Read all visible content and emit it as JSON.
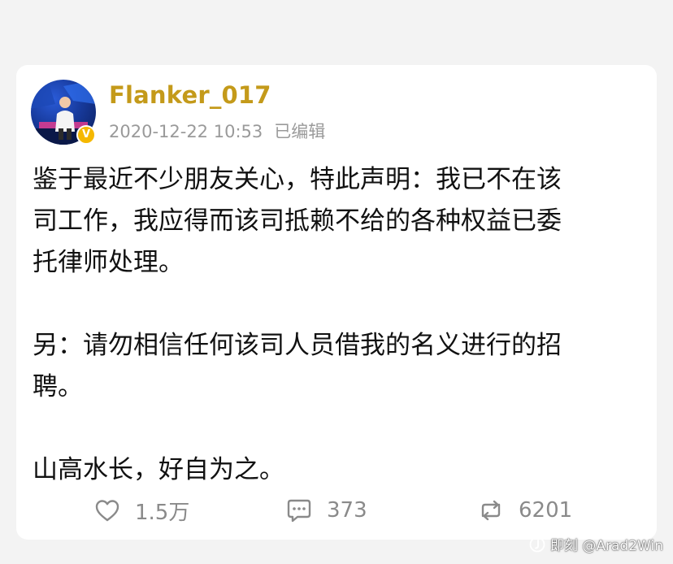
{
  "post": {
    "username": "Flanker_017",
    "datetime": "2020-12-22 10:53",
    "edited_label": "已编辑",
    "verified_mark": "V",
    "paragraphs": [
      [
        "鉴于最近不少朋友关心，特此声明：我已不在该",
        "司工作，我应得而该司抵赖不给的各种权益已委",
        "托律师处理。"
      ],
      [
        "另：请勿相信任何该司人员借我的名义进行的招",
        "聘。"
      ],
      [
        "山高水长，好自为之。"
      ]
    ]
  },
  "actions": {
    "likes": "1.5万",
    "comments": "373",
    "reposts": "6201"
  },
  "watermark": {
    "text": "即刻 @Arad2Win"
  },
  "colors": {
    "username": "#c49a1a",
    "meta": "#9a9a9a",
    "body_text": "#111111",
    "action": "#8a8a8a",
    "verified_badge": "#f5b800",
    "background": "#f3f3f3",
    "card": "#ffffff"
  },
  "icons": {
    "like": "heart-outline-icon",
    "comment": "speech-bubble-icon",
    "repost": "repost-arrows-icon",
    "verified": "verified-v-badge-icon"
  }
}
